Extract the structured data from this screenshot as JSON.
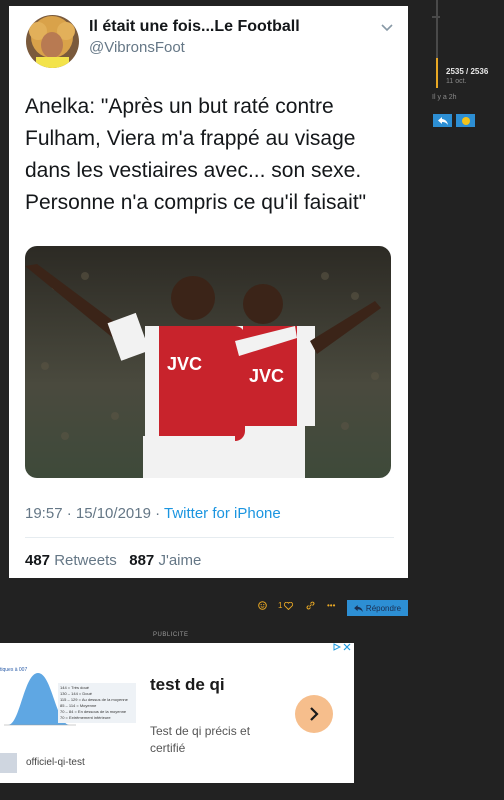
{
  "tweet": {
    "author_name": "Il était une fois...Le Football",
    "author_handle": "@VibronsFoot",
    "text": "Anelka: \"Après un but raté contre Fulham, Viera m'a frappé au visage dans les vestiaires avec... son sexe. Personne n'a compris ce qu'il faisait\"",
    "time": "19:57 · 15/10/2019 · ",
    "source": "Twitter for iPhone",
    "retweets_count": "487",
    "retweets_label": "Retweets",
    "likes_count": "887",
    "likes_label": "J'aime",
    "photo_sponsor_a": "JVC",
    "photo_sponsor_b": "JVC"
  },
  "sidebar": {
    "progress_count": "2535 / 2536",
    "progress_date": "11 oct.",
    "ago": "Il y a 2h"
  },
  "actions": {
    "likes_count": "1",
    "more": "•••",
    "reply_label": "Répondre"
  },
  "ad": {
    "label": "PUBLICITE",
    "title": "test de qi",
    "description": "Test de qi précis et certifié",
    "source": "officiel-qi-test",
    "chart_title": "tiques à 007",
    "chart_legend": [
      "144 = Très doué",
      "130 – 144 = Doué",
      "115 – 129 = Au dessus de la moyenne",
      "85 – 114 = Moyenne",
      "70 – 84 = En dessous de la moyenne",
      "70 = Extrêmement inférieure"
    ]
  },
  "colors": {
    "accent_orange": "#e9a824",
    "accent_blue": "#2d8fd4",
    "link_blue": "#1b95e0",
    "background": "#222222"
  }
}
